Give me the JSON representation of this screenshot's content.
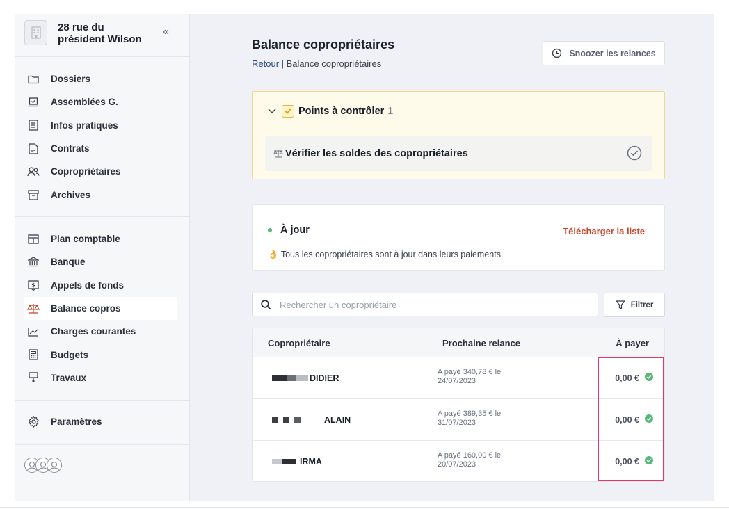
{
  "sidebar": {
    "building_name": "28 rue du\nprésident Wilson",
    "nav_group1": [
      {
        "label": "Dossiers",
        "icon": "folder-icon"
      },
      {
        "label": "Assemblées G.",
        "icon": "laptop-check-icon"
      },
      {
        "label": "Infos pratiques",
        "icon": "document-lines-icon"
      },
      {
        "label": "Contrats",
        "icon": "contract-icon"
      },
      {
        "label": "Copropriétaires",
        "icon": "users-icon"
      },
      {
        "label": "Archives",
        "icon": "archive-icon"
      }
    ],
    "nav_group2": [
      {
        "label": "Plan comptable",
        "icon": "table-icon"
      },
      {
        "label": "Banque",
        "icon": "bank-icon"
      },
      {
        "label": "Appels de fonds",
        "icon": "dollar-icon"
      },
      {
        "label": "Balance copros",
        "icon": "scale-icon",
        "active": true
      },
      {
        "label": "Charges courantes",
        "icon": "chart-line-icon"
      },
      {
        "label": "Budgets",
        "icon": "calculator-icon"
      },
      {
        "label": "Travaux",
        "icon": "paint-roller-icon"
      }
    ],
    "settings_label": "Paramètres"
  },
  "header": {
    "title": "Balance copropriétaires",
    "breadcrumb_back": "Retour",
    "breadcrumb_separator": " | ",
    "breadcrumb_current": "Balance copropriétaires",
    "snooze_label": "Snoozer les relances"
  },
  "points": {
    "title": "Points à contrôler",
    "count": "1",
    "task_label": "Vérifier les soldes des copropriétaires"
  },
  "status": {
    "title": "À jour",
    "download_label": "Télécharger la liste",
    "emoji": "👌",
    "message": "Tous les copropriétaires sont à jour dans leurs paiements."
  },
  "search": {
    "placeholder": "Rechercher un copropriétaire",
    "filter_label": "Filtrer"
  },
  "table": {
    "columns": [
      "Copropriétaire",
      "Prochaine relance",
      "À payer"
    ],
    "rows": [
      {
        "name": "DIDIER",
        "relance": "A payé 340,78 € le 24/07/2023",
        "amount": "0,00 €"
      },
      {
        "name": "ALAIN",
        "relance": "A payé 389,35 € le 31/07/2023",
        "amount": "0,00 €"
      },
      {
        "name": "IRMA",
        "relance": "A payé 160,00 € le 20/07/2023",
        "amount": "0,00 €"
      }
    ]
  },
  "colors": {
    "accent_red": "#c8462b",
    "success_green": "#56b97a",
    "highlight_pink": "#df3a66",
    "warning_bg": "#fffbea"
  }
}
